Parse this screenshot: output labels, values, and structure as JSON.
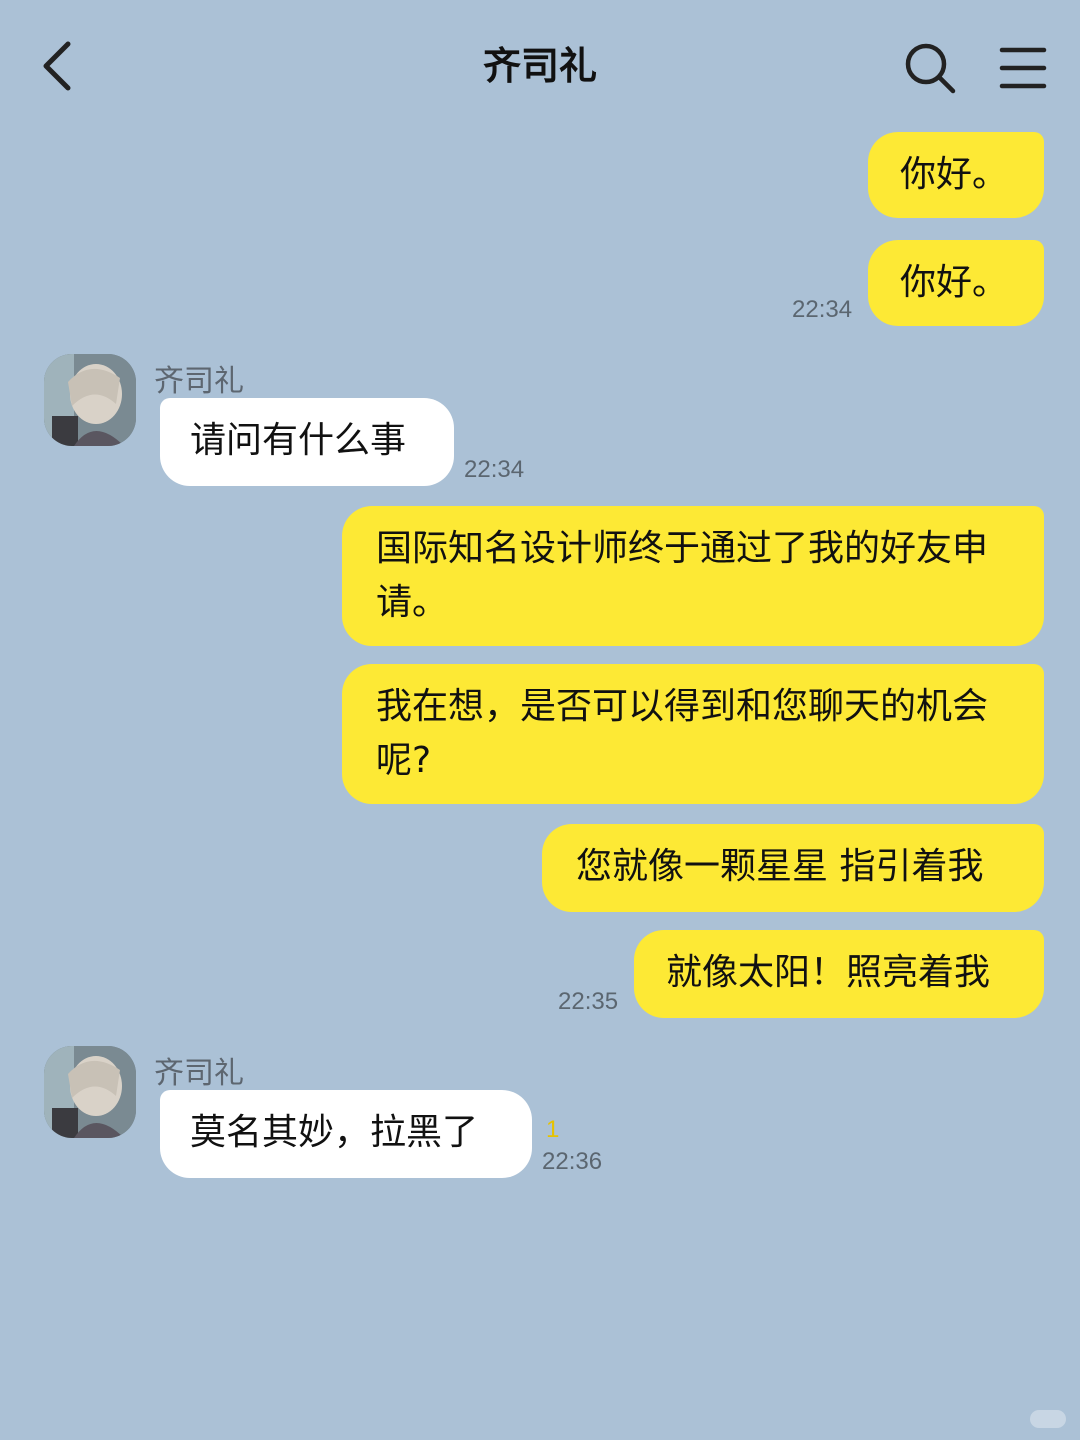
{
  "header": {
    "title": "齐司礼",
    "back_icon": "chevron-left-icon",
    "search_icon": "search-icon",
    "menu_icon": "menu-icon"
  },
  "colors": {
    "background": "#abc1d6",
    "outgoing_bubble": "#fde935",
    "incoming_bubble": "#ffffff",
    "unread_badge": "#e6c200"
  },
  "messages": {
    "m1": {
      "text": "你好。"
    },
    "m2": {
      "text": "你好。",
      "time": "22:34"
    },
    "m3": {
      "sender": "齐司礼",
      "text": "请问有什么事",
      "time": "22:34"
    },
    "m4": {
      "text": "国际知名设计师终于通过了我的好友申请。"
    },
    "m5": {
      "text": "我在想，是否可以得到和您聊天的机会呢?"
    },
    "m6": {
      "text": "您就像一颗星星 指引着我"
    },
    "m7": {
      "text": "就像太阳！照亮着我",
      "time": "22:35"
    },
    "m8": {
      "sender": "齐司礼",
      "text": "莫名其妙，拉黑了",
      "unread": "1",
      "time": "22:36"
    }
  }
}
